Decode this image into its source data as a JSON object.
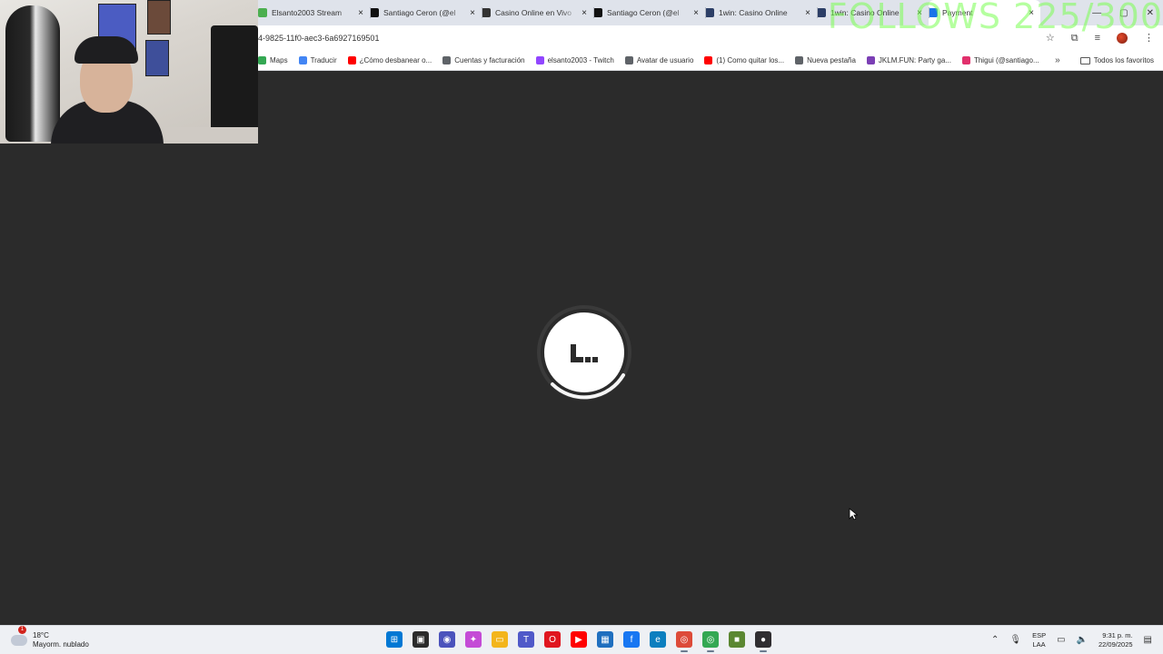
{
  "browser": {
    "tabs": [
      {
        "title": "Elsanto2003 Stream",
        "favicon_color": "#4caf50",
        "active": false
      },
      {
        "title": "Santiago Ceron (@el",
        "favicon_color": "#111111",
        "active": false
      },
      {
        "title": "Casino Online en Vivo",
        "favicon_color": "#333333",
        "active": false
      },
      {
        "title": "Santiago Ceron (@el",
        "favicon_color": "#111111",
        "active": false
      },
      {
        "title": "1win: Casino Online",
        "favicon_color": "#2c3e66",
        "active": false
      },
      {
        "title": "1win: Casino Online",
        "favicon_color": "#2c3e66",
        "active": false
      },
      {
        "title": "Payment",
        "favicon_color": "#1a73e8",
        "active": true
      }
    ],
    "tab_close_glyph": "×",
    "url": "4-9825-11f0-aec3-6a6927169501",
    "bookmarks": [
      {
        "label": "Maps",
        "color": "#34a853"
      },
      {
        "label": "Traducir",
        "color": "#4285f4"
      },
      {
        "label": "¿Cómo desbanear o...",
        "color": "#ff0000"
      },
      {
        "label": "Cuentas y facturación",
        "color": "#5f6368"
      },
      {
        "label": "elsanto2003 - Twitch",
        "color": "#9146ff"
      },
      {
        "label": "Avatar de usuario",
        "color": "#5f6368"
      },
      {
        "label": "(1) Como quitar los...",
        "color": "#ff0000"
      },
      {
        "label": "Nueva pestaña",
        "color": "#5f6368"
      },
      {
        "label": "JKLM.FUN: Party ga...",
        "color": "#7b3fb5"
      },
      {
        "label": "Thigui (@santiago...",
        "color": "#e1306c"
      }
    ],
    "bookmarks_more": "»",
    "all_bookmarks_label": "Todos los favoritos"
  },
  "overlay": {
    "follows_text": "FOLLOWS 225/300"
  },
  "taskbar": {
    "weather_temp": "18°C",
    "weather_desc": "Mayorm. nublado",
    "weather_badge": "1",
    "lang_line1": "ESP",
    "lang_line2": "LAA",
    "time": "9:31 p. m.",
    "date": "22/09/2025",
    "apps": [
      {
        "name": "start",
        "color": "#0078d4",
        "glyph": "⊞"
      },
      {
        "name": "task-view",
        "color": "#2b2b2b",
        "glyph": "▣"
      },
      {
        "name": "chat",
        "color": "#4b53bc",
        "glyph": "◉"
      },
      {
        "name": "copilot",
        "color": "#c44bd6",
        "glyph": "✦"
      },
      {
        "name": "file-explorer",
        "color": "#f3b51b",
        "glyph": "▭"
      },
      {
        "name": "teams",
        "color": "#5059c9",
        "glyph": "T"
      },
      {
        "name": "opera",
        "color": "#e0161f",
        "glyph": "O"
      },
      {
        "name": "youtube",
        "color": "#ff0000",
        "glyph": "▶"
      },
      {
        "name": "store",
        "color": "#1f6fbf",
        "glyph": "▦"
      },
      {
        "name": "facebook",
        "color": "#1877f2",
        "glyph": "f"
      },
      {
        "name": "edge",
        "color": "#0c7fbf",
        "glyph": "e"
      },
      {
        "name": "chrome",
        "color": "#dd4b39",
        "glyph": "◎"
      },
      {
        "name": "chrome-profile",
        "color": "#34a853",
        "glyph": "◎"
      },
      {
        "name": "minecraft",
        "color": "#5b8731",
        "glyph": "■"
      },
      {
        "name": "obs",
        "color": "#302e31",
        "glyph": "●"
      }
    ]
  }
}
